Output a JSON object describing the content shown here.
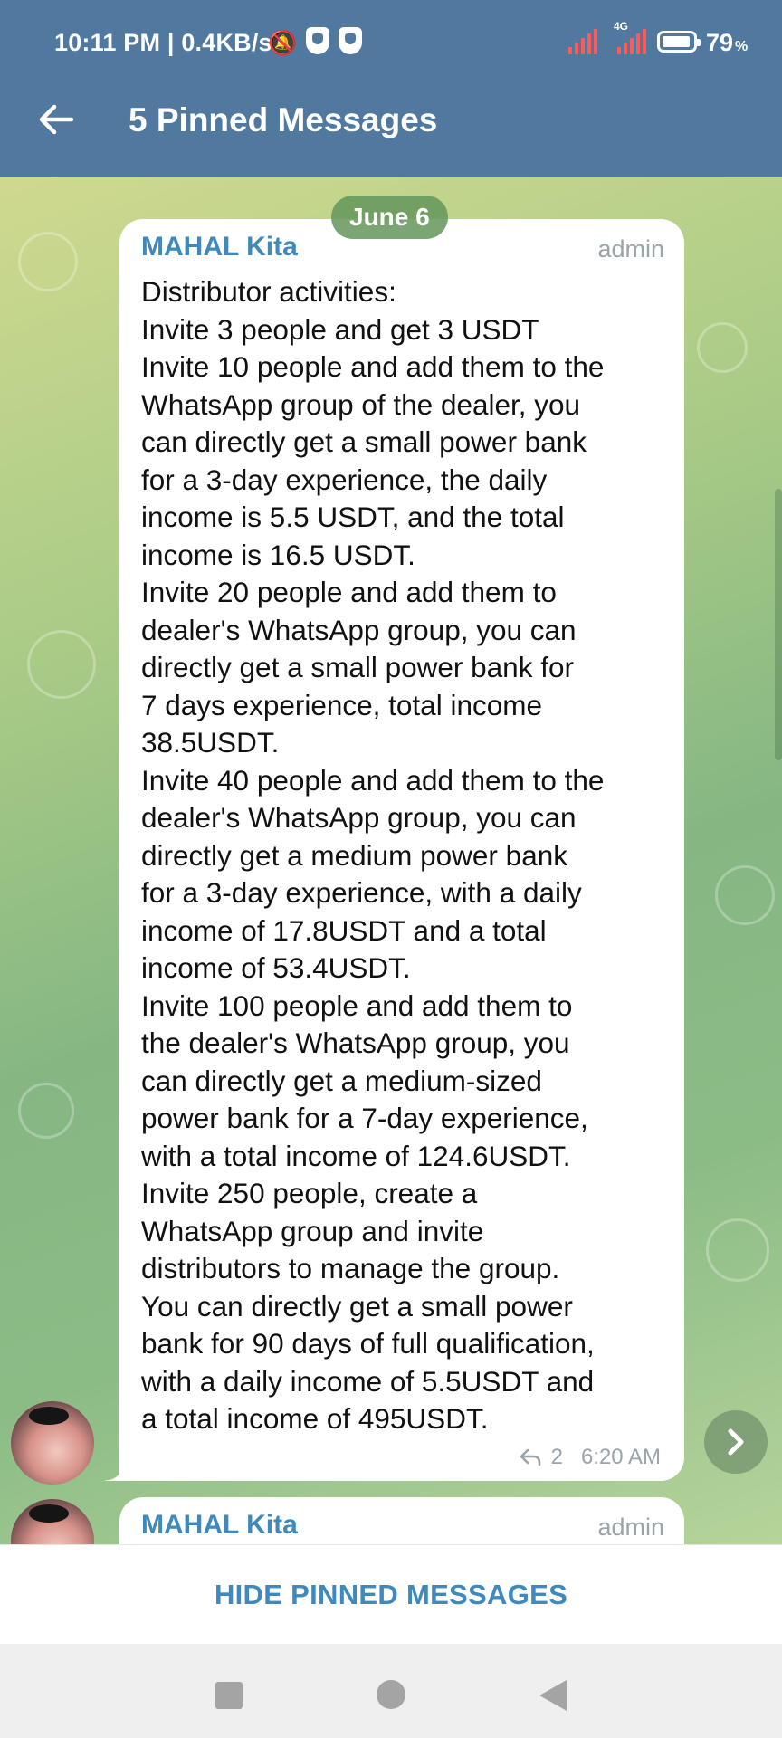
{
  "status_bar": {
    "time": "10:11 PM | 0.4KB/s",
    "network_label": "4G",
    "battery_percent": "79",
    "battery_unit": "%"
  },
  "header": {
    "title": "5 Pinned Messages",
    "back_icon": "arrow-left-icon"
  },
  "chat": {
    "date_label": "June 6",
    "messages": [
      {
        "sender": "MAHAL Kita",
        "role": "admin",
        "lines": [
          "Distributor activities:",
          "Invite 3 people and get 3 USDT",
          "Invite 10 people and add them to the",
          "WhatsApp group of the dealer, you",
          "can directly get a small power bank",
          "for a 3-day experience, the daily",
          "income is 5.5 USDT, and the total",
          "income is 16.5 USDT.",
          "Invite 20 people and add them to",
          "dealer's WhatsApp group, you can",
          "directly get a small power bank for",
          "7 days experience, total income",
          "38.5USDT.",
          "Invite 40 people and add them to the",
          "dealer's WhatsApp group, you can",
          "directly get a medium power bank",
          "for a 3-day experience, with a daily",
          "income of 17.8USDT and a total",
          "income of 53.4USDT.",
          "Invite 100 people and add them to",
          "the dealer's WhatsApp group, you",
          "can directly get a medium-sized",
          "power bank for a 7-day experience,",
          "with a total income of 124.6USDT.",
          "Invite 250 people, create a",
          "WhatsApp group and invite",
          "distributors to manage the group.",
          "You can directly get a small power",
          "bank for 90 days of full qualification,",
          "with a daily income of 5.5USDT and",
          "a total income of 495USDT."
        ],
        "reply_count": "2",
        "time": "6:20 AM"
      },
      {
        "sender": "MAHAL Kita",
        "role": "admin"
      }
    ]
  },
  "footer": {
    "hide_label": "HIDE PINNED MESSAGES"
  },
  "colors": {
    "header": "#51799f",
    "link": "#3e89bd"
  }
}
